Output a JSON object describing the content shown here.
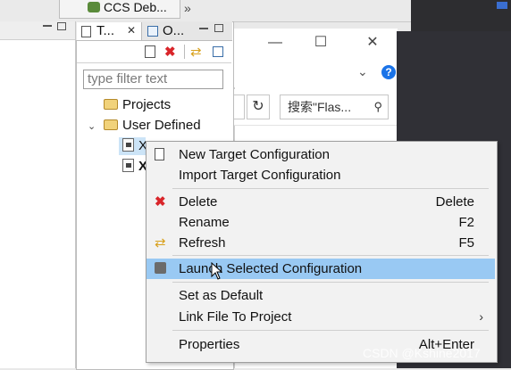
{
  "perspective": {
    "label": "CCS Deb...",
    "overflow": "»"
  },
  "target_view": {
    "tab_title": "T...",
    "tab_close": "✕",
    "other_tab_title": "O...",
    "filter_placeholder": "type filter text",
    "tree": [
      {
        "label": "Projects",
        "type": "folder",
        "indent": 0
      },
      {
        "label": "User Defined",
        "type": "folder",
        "expanded": true,
        "indent": 0
      },
      {
        "label": "X",
        "type": "file",
        "indent": 1,
        "selected": true
      },
      {
        "label": "X",
        "type": "file",
        "indent": 1
      }
    ]
  },
  "explorer": {
    "search_placeholder": "搜索\"Flas...",
    "minimize": "—",
    "maximize": "☐",
    "close": "✕"
  },
  "context_menu": {
    "groups": [
      [
        {
          "label": "New Target Configuration",
          "icon": "new-config-icon"
        },
        {
          "label": "Import Target Configuration"
        }
      ],
      [
        {
          "label": "Delete",
          "accel": "Delete",
          "icon": "delete-icon"
        },
        {
          "label": "Rename",
          "accel": "F2"
        },
        {
          "label": "Refresh",
          "accel": "F5",
          "icon": "refresh-icon"
        }
      ],
      [
        {
          "label": "Launch Selected Configuration",
          "icon": "launch-icon",
          "highlighted": true
        }
      ],
      [
        {
          "label": "Set as Default"
        },
        {
          "label": "Link File To Project",
          "submenu": true
        }
      ],
      [
        {
          "label": "Properties",
          "accel": "Alt+Enter"
        }
      ]
    ]
  },
  "watermark": "CSDN @Kshine2017",
  "colors": {
    "highlight": "#99c9f3",
    "delete_red": "#d9252a",
    "help_blue": "#1a73e8"
  }
}
